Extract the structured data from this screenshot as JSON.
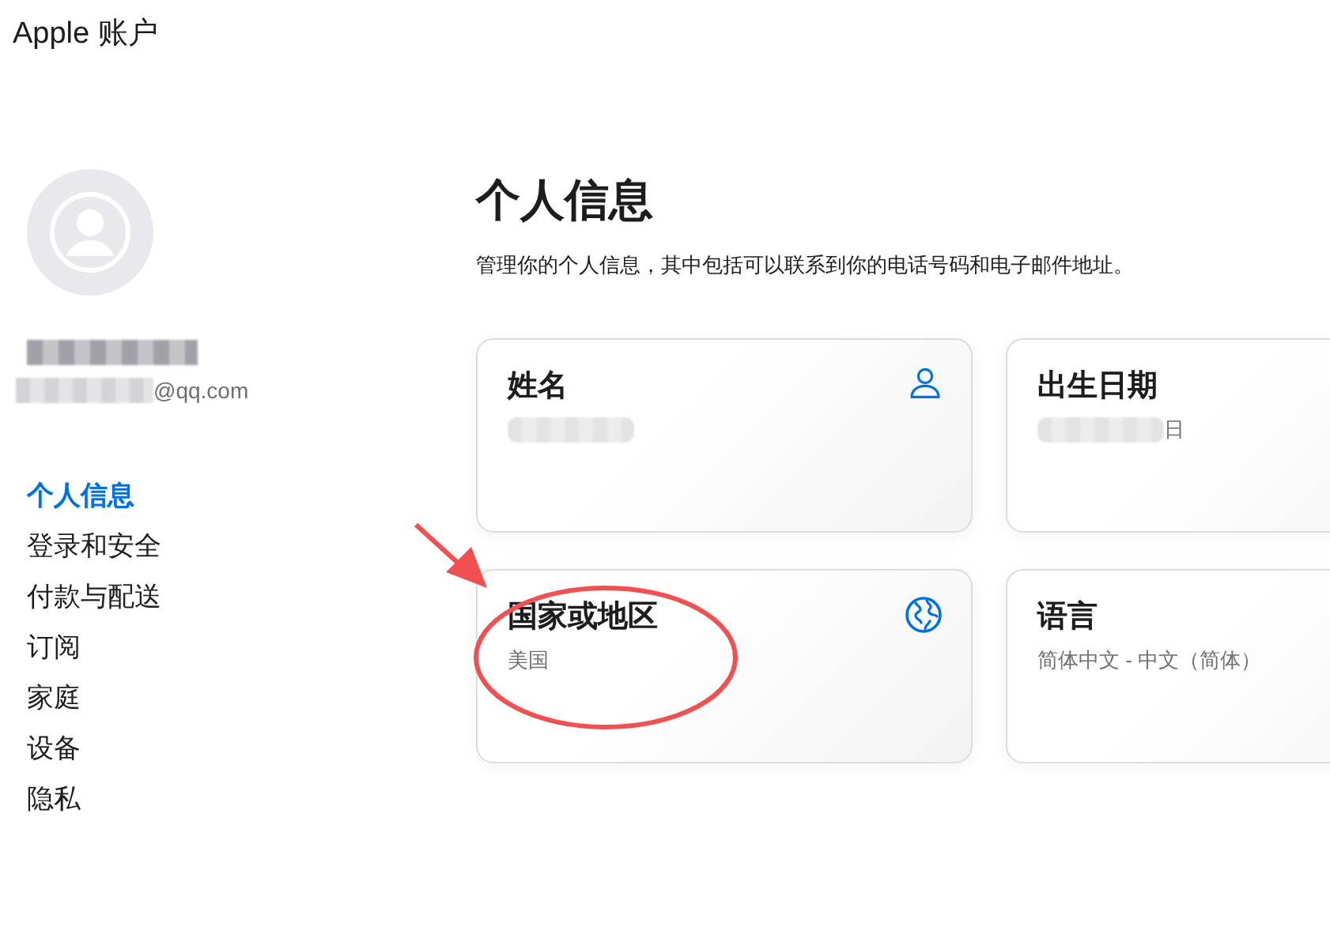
{
  "header": {
    "title": "Apple 账户"
  },
  "profile": {
    "name_redacted": true,
    "email": "@qq.com",
    "email_redacted": true
  },
  "sidebar": {
    "items": [
      {
        "label": "个人信息",
        "selected": true
      },
      {
        "label": "登录和安全",
        "selected": false
      },
      {
        "label": "付款与配送",
        "selected": false
      },
      {
        "label": "订阅",
        "selected": false
      },
      {
        "label": "家庭",
        "selected": false
      },
      {
        "label": "设备",
        "selected": false
      },
      {
        "label": "隐私",
        "selected": false
      }
    ]
  },
  "main": {
    "title": "个人信息",
    "description": "管理你的个人信息，其中包括可以联系到你的电话号码和电子邮件地址。",
    "cards": [
      {
        "title": "姓名",
        "kind": "person",
        "redacted": true
      },
      {
        "title": "出生日期",
        "kind": "plain",
        "redacted": true,
        "value": "日"
      },
      {
        "title": "国家或地区",
        "kind": "region",
        "redacted": false,
        "value": "美国"
      },
      {
        "title": "语言",
        "kind": "plain",
        "redacted": false,
        "value": "简体中文 - 中文（简体）"
      }
    ]
  },
  "annotation": {
    "arrow": true,
    "ellipse": true
  }
}
